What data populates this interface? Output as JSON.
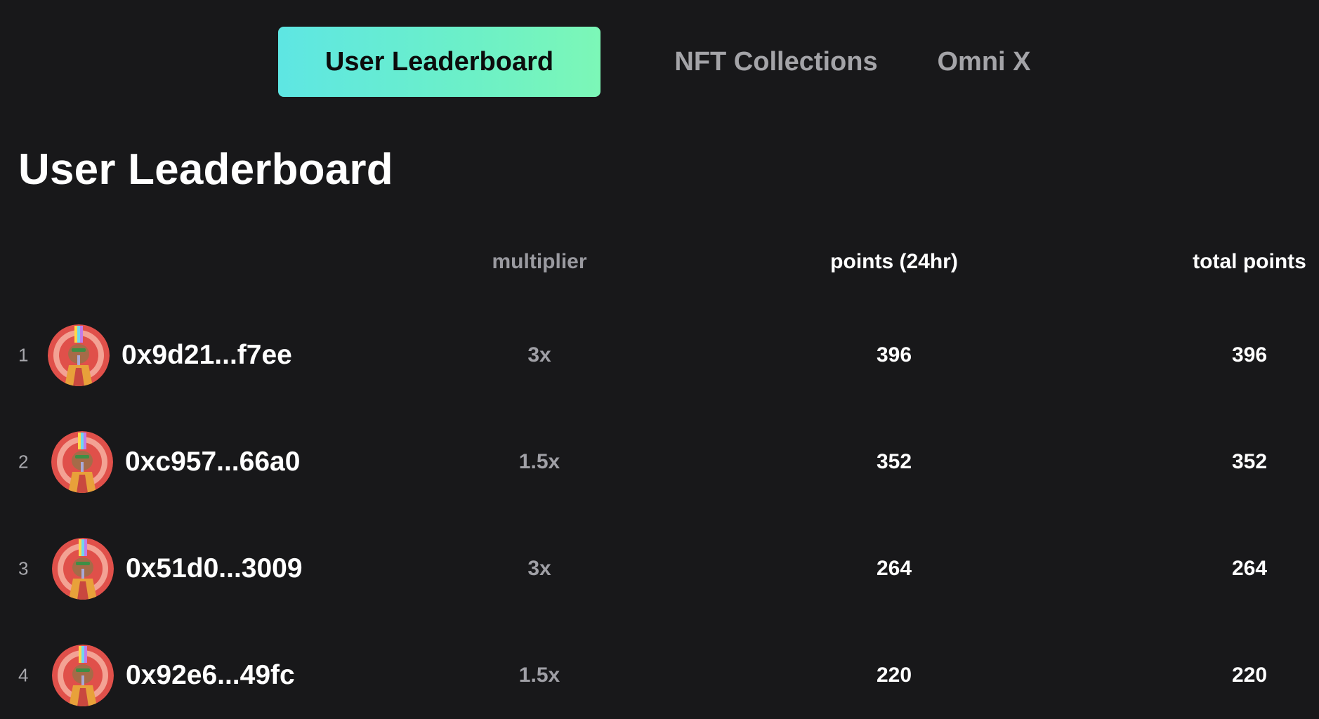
{
  "tabs": [
    {
      "label": "User Leaderboard",
      "active": true
    },
    {
      "label": "NFT Collections",
      "active": false
    },
    {
      "label": "Omni X",
      "active": false
    }
  ],
  "page_title": "User Leaderboard",
  "columns": {
    "multiplier": "multiplier",
    "points_24hr": "points (24hr)",
    "total_points": "total points"
  },
  "rows": [
    {
      "rank": "1",
      "address": "0x9d21...f7ee",
      "multiplier": "3x",
      "points_24hr": "396",
      "total_points": "396"
    },
    {
      "rank": "2",
      "address": "0xc957...66a0",
      "multiplier": "1.5x",
      "points_24hr": "352",
      "total_points": "352"
    },
    {
      "rank": "3",
      "address": "0x51d0...3009",
      "multiplier": "3x",
      "points_24hr": "264",
      "total_points": "264"
    },
    {
      "rank": "4",
      "address": "0x92e6...49fc",
      "multiplier": "1.5x",
      "points_24hr": "220",
      "total_points": "220"
    }
  ],
  "colors": {
    "background": "#18181a",
    "accent_gradient_start": "#5ee6e3",
    "accent_gradient_end": "#7cf7b7",
    "inactive_tab": "#a4a4a8",
    "muted_text": "#9a9aa0"
  },
  "icons": {
    "avatar": "user-avatar-icon"
  }
}
